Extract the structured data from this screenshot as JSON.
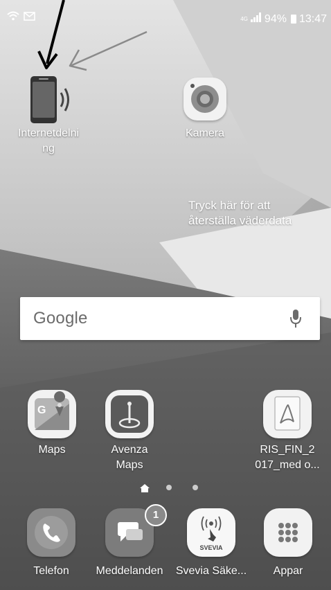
{
  "status_bar": {
    "network": "4G",
    "signal_bars": 4,
    "battery": "94%",
    "time": "13:47",
    "icons": [
      "wifi-icon",
      "mail-icon"
    ]
  },
  "home": {
    "apps_top": [
      {
        "label_lines": [
          "Internetdelni",
          "ng"
        ],
        "icon": "tethering-icon"
      },
      {
        "label_lines": [
          "Kamera"
        ],
        "icon": "camera-icon"
      }
    ],
    "weather_prompt_lines": [
      "Tryck här för att",
      "återställa väderdata"
    ],
    "search": {
      "logo": "Google",
      "icon": "mic-icon"
    },
    "apps_row": [
      {
        "label_lines": [
          "Maps"
        ],
        "icon": "google-maps-icon"
      },
      {
        "label_lines": [
          "Avenza",
          "Maps"
        ],
        "icon": "avenza-maps-icon"
      },
      {
        "label_lines": [
          "RIS_FIN_2",
          "017_med o..."
        ],
        "icon": "pdf-icon"
      }
    ],
    "page_dots": {
      "count": 3,
      "active": 0,
      "home_icon": "home-icon"
    }
  },
  "dock": [
    {
      "label": "Telefon",
      "icon": "phone-icon"
    },
    {
      "label": "Meddelanden",
      "icon": "messages-icon",
      "badge": "1"
    },
    {
      "label": "Svevia Säke...",
      "icon": "svevia-icon",
      "logo_text": "SVEVIA"
    },
    {
      "label": "Appar",
      "icon": "apps-grid-icon"
    }
  ],
  "colors": {
    "wallpaper_light": "#d6d6d6",
    "wallpaper_dark": "#4a4a4a",
    "tile_bg": "#f2f2f2",
    "icon_dark": "#555555",
    "accent_gray": "#8a8a8a"
  }
}
